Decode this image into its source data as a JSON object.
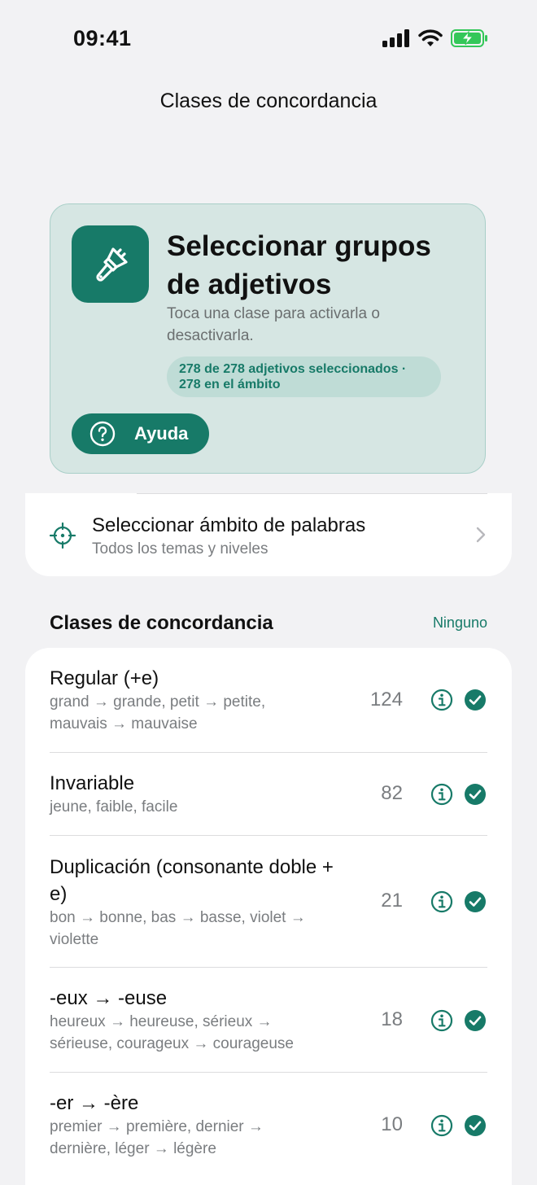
{
  "status_bar": {
    "time": "09:41"
  },
  "nav": {
    "title": "Clases de concordancia"
  },
  "hero": {
    "icon": "paintbrush-icon",
    "title": "Seleccionar grupos de adjetivos",
    "subtitle": "Toca una clase para activarla o desactivarla.",
    "badge": "278 de 278 adjetivos seleccionados · 278 en el ámbito",
    "help_label": "Ayuda"
  },
  "scope": {
    "title": "Seleccionar ámbito de palabras",
    "subtitle": "Todos los temas y niveles"
  },
  "section": {
    "title": "Clases de concordancia",
    "action": "Ninguno"
  },
  "classes": [
    {
      "title": "Regular (+e)",
      "examples": "grand → grande, petit → petite, mauvais → mauvaise",
      "count": "124",
      "selected": true
    },
    {
      "title": "Invariable",
      "examples": "jeune, faible, facile",
      "count": "82",
      "selected": true
    },
    {
      "title": "Duplicación (consonante doble + e)",
      "examples": "bon → bonne, bas → basse, violet → violette",
      "count": "21",
      "selected": true
    },
    {
      "title": "-eux → -euse",
      "examples": "heureux → heureuse, sérieux → sérieuse, courageux → courageuse",
      "count": "18",
      "selected": true
    },
    {
      "title": "-er → -ère",
      "examples": "premier → première, dernier → dernière, léger → légère",
      "count": "10",
      "selected": true
    }
  ],
  "colors": {
    "accent": "#177a68",
    "hero_bg": "#d6e6e3",
    "badge_bg": "#bfdcd6"
  }
}
